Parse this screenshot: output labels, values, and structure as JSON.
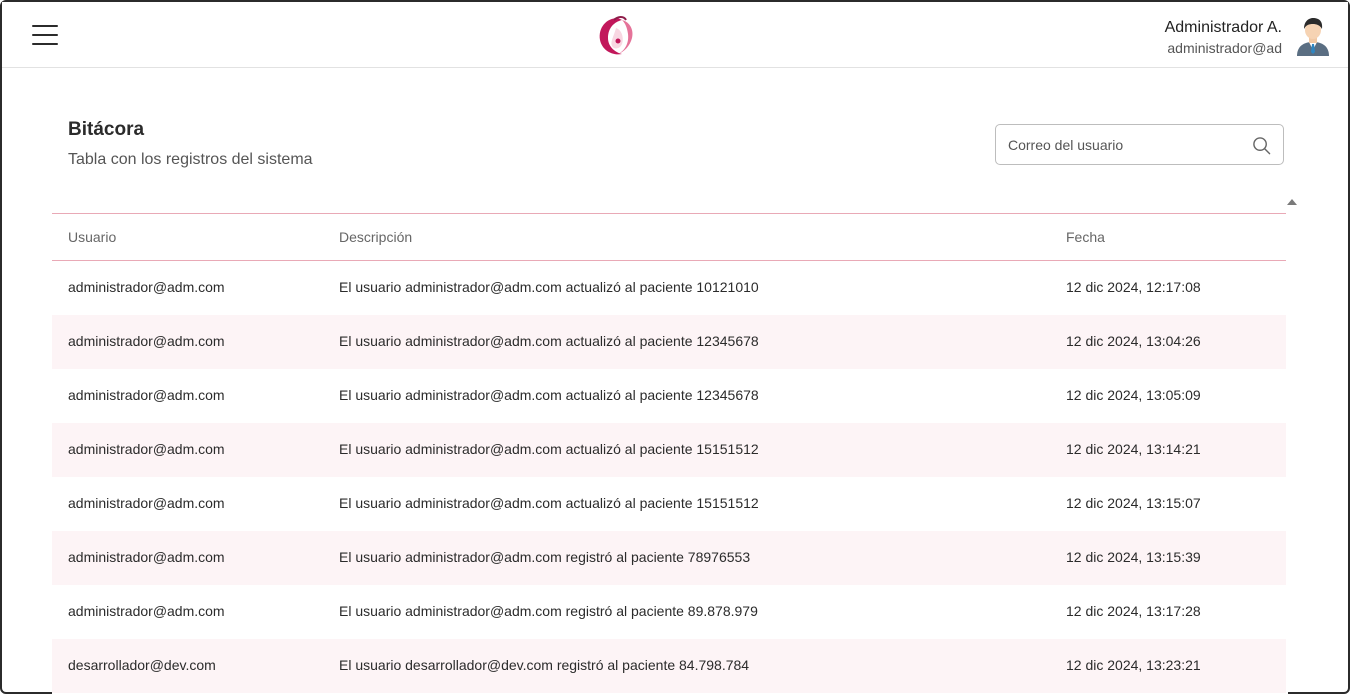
{
  "header": {
    "user_name": "Administrador A.",
    "user_email": "administrador@ad",
    "brand_color": "#c2185b"
  },
  "page": {
    "title": "Bitácora",
    "subtitle": "Tabla con los registros del sistema"
  },
  "search": {
    "placeholder": "Correo del usuario",
    "value": ""
  },
  "table": {
    "columns": [
      "Usuario",
      "Descripción",
      "Fecha"
    ],
    "rows": [
      [
        "administrador@adm.com",
        "El usuario administrador@adm.com actualizó al paciente 10121010",
        "12 dic 2024, 12:17:08"
      ],
      [
        "administrador@adm.com",
        "El usuario administrador@adm.com actualizó al paciente 12345678",
        "12 dic 2024, 13:04:26"
      ],
      [
        "administrador@adm.com",
        "El usuario administrador@adm.com actualizó al paciente 12345678",
        "12 dic 2024, 13:05:09"
      ],
      [
        "administrador@adm.com",
        "El usuario administrador@adm.com actualizó al paciente 15151512",
        "12 dic 2024, 13:14:21"
      ],
      [
        "administrador@adm.com",
        "El usuario administrador@adm.com actualizó al paciente 15151512",
        "12 dic 2024, 13:15:07"
      ],
      [
        "administrador@adm.com",
        "El usuario administrador@adm.com registró al paciente 78976553",
        "12 dic 2024, 13:15:39"
      ],
      [
        "administrador@adm.com",
        "El usuario administrador@adm.com registró al paciente 89.878.979",
        "12 dic 2024, 13:17:28"
      ],
      [
        "desarrollador@dev.com",
        "El usuario desarrollador@dev.com registró al paciente 84.798.784",
        "12 dic 2024, 13:23:21"
      ]
    ]
  },
  "icons": {
    "menu": "hamburger-icon",
    "logo": "app-logo",
    "avatar": "user-avatar",
    "search": "search-icon",
    "sort": "sort-up-icon"
  }
}
